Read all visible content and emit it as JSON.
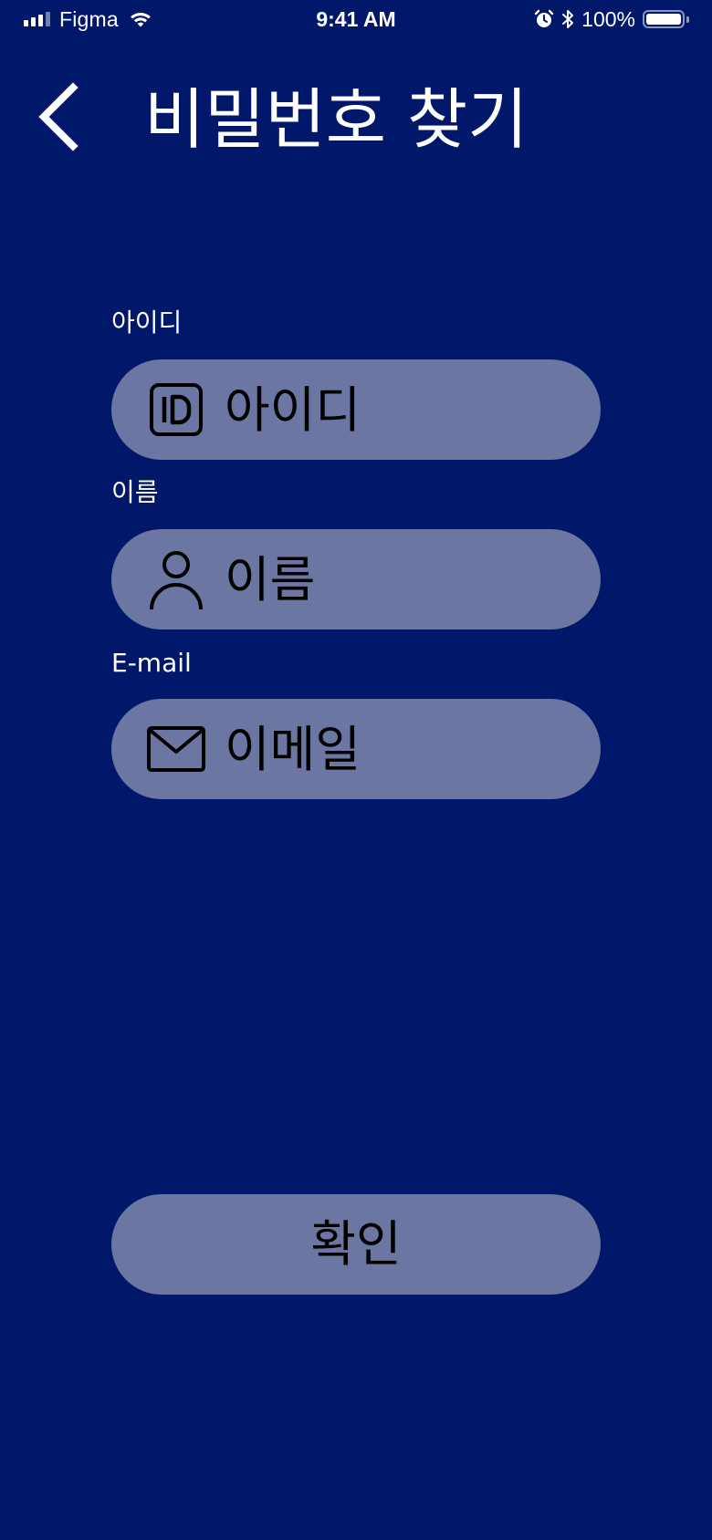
{
  "status_bar": {
    "carrier": "Figma",
    "time": "9:41 AM",
    "battery_percent": "100%",
    "battery_level": 1.0,
    "icons": [
      "signal-icon",
      "wifi-icon",
      "alarm-icon",
      "bluetooth-icon",
      "battery-icon"
    ]
  },
  "header": {
    "title": "비밀번호 찾기",
    "back_icon": "chevron-left-icon"
  },
  "form": {
    "fields": [
      {
        "label": "아이디",
        "placeholder": "아이디",
        "value": "",
        "icon": "id-card-icon"
      },
      {
        "label": "이름",
        "placeholder": "이름",
        "value": "",
        "icon": "person-icon"
      },
      {
        "label": "E-mail",
        "placeholder": "이메일",
        "value": "",
        "icon": "mail-icon"
      }
    ],
    "submit_label": "확인"
  },
  "colors": {
    "background": "#00176A",
    "field_fill": "#6B76A2",
    "text_on_background": "#FFFFFF",
    "text_on_field": "#000000"
  }
}
